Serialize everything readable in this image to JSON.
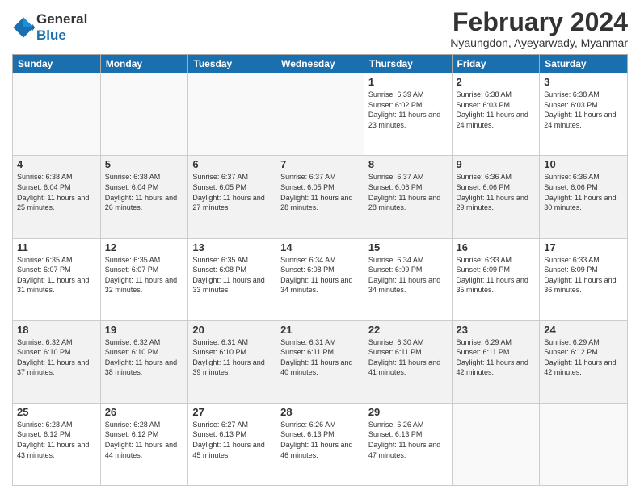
{
  "header": {
    "logo_line1": "General",
    "logo_line2": "Blue",
    "month_title": "February 2024",
    "location": "Nyaungdon, Ayeyarwady, Myanmar"
  },
  "weekdays": [
    "Sunday",
    "Monday",
    "Tuesday",
    "Wednesday",
    "Thursday",
    "Friday",
    "Saturday"
  ],
  "weeks": [
    [
      {
        "day": "",
        "sunrise": "",
        "sunset": "",
        "daylight": ""
      },
      {
        "day": "",
        "sunrise": "",
        "sunset": "",
        "daylight": ""
      },
      {
        "day": "",
        "sunrise": "",
        "sunset": "",
        "daylight": ""
      },
      {
        "day": "",
        "sunrise": "",
        "sunset": "",
        "daylight": ""
      },
      {
        "day": "1",
        "sunrise": "Sunrise: 6:39 AM",
        "sunset": "Sunset: 6:02 PM",
        "daylight": "Daylight: 11 hours and 23 minutes."
      },
      {
        "day": "2",
        "sunrise": "Sunrise: 6:38 AM",
        "sunset": "Sunset: 6:03 PM",
        "daylight": "Daylight: 11 hours and 24 minutes."
      },
      {
        "day": "3",
        "sunrise": "Sunrise: 6:38 AM",
        "sunset": "Sunset: 6:03 PM",
        "daylight": "Daylight: 11 hours and 24 minutes."
      }
    ],
    [
      {
        "day": "4",
        "sunrise": "Sunrise: 6:38 AM",
        "sunset": "Sunset: 6:04 PM",
        "daylight": "Daylight: 11 hours and 25 minutes."
      },
      {
        "day": "5",
        "sunrise": "Sunrise: 6:38 AM",
        "sunset": "Sunset: 6:04 PM",
        "daylight": "Daylight: 11 hours and 26 minutes."
      },
      {
        "day": "6",
        "sunrise": "Sunrise: 6:37 AM",
        "sunset": "Sunset: 6:05 PM",
        "daylight": "Daylight: 11 hours and 27 minutes."
      },
      {
        "day": "7",
        "sunrise": "Sunrise: 6:37 AM",
        "sunset": "Sunset: 6:05 PM",
        "daylight": "Daylight: 11 hours and 28 minutes."
      },
      {
        "day": "8",
        "sunrise": "Sunrise: 6:37 AM",
        "sunset": "Sunset: 6:06 PM",
        "daylight": "Daylight: 11 hours and 28 minutes."
      },
      {
        "day": "9",
        "sunrise": "Sunrise: 6:36 AM",
        "sunset": "Sunset: 6:06 PM",
        "daylight": "Daylight: 11 hours and 29 minutes."
      },
      {
        "day": "10",
        "sunrise": "Sunrise: 6:36 AM",
        "sunset": "Sunset: 6:06 PM",
        "daylight": "Daylight: 11 hours and 30 minutes."
      }
    ],
    [
      {
        "day": "11",
        "sunrise": "Sunrise: 6:35 AM",
        "sunset": "Sunset: 6:07 PM",
        "daylight": "Daylight: 11 hours and 31 minutes."
      },
      {
        "day": "12",
        "sunrise": "Sunrise: 6:35 AM",
        "sunset": "Sunset: 6:07 PM",
        "daylight": "Daylight: 11 hours and 32 minutes."
      },
      {
        "day": "13",
        "sunrise": "Sunrise: 6:35 AM",
        "sunset": "Sunset: 6:08 PM",
        "daylight": "Daylight: 11 hours and 33 minutes."
      },
      {
        "day": "14",
        "sunrise": "Sunrise: 6:34 AM",
        "sunset": "Sunset: 6:08 PM",
        "daylight": "Daylight: 11 hours and 34 minutes."
      },
      {
        "day": "15",
        "sunrise": "Sunrise: 6:34 AM",
        "sunset": "Sunset: 6:09 PM",
        "daylight": "Daylight: 11 hours and 34 minutes."
      },
      {
        "day": "16",
        "sunrise": "Sunrise: 6:33 AM",
        "sunset": "Sunset: 6:09 PM",
        "daylight": "Daylight: 11 hours and 35 minutes."
      },
      {
        "day": "17",
        "sunrise": "Sunrise: 6:33 AM",
        "sunset": "Sunset: 6:09 PM",
        "daylight": "Daylight: 11 hours and 36 minutes."
      }
    ],
    [
      {
        "day": "18",
        "sunrise": "Sunrise: 6:32 AM",
        "sunset": "Sunset: 6:10 PM",
        "daylight": "Daylight: 11 hours and 37 minutes."
      },
      {
        "day": "19",
        "sunrise": "Sunrise: 6:32 AM",
        "sunset": "Sunset: 6:10 PM",
        "daylight": "Daylight: 11 hours and 38 minutes."
      },
      {
        "day": "20",
        "sunrise": "Sunrise: 6:31 AM",
        "sunset": "Sunset: 6:10 PM",
        "daylight": "Daylight: 11 hours and 39 minutes."
      },
      {
        "day": "21",
        "sunrise": "Sunrise: 6:31 AM",
        "sunset": "Sunset: 6:11 PM",
        "daylight": "Daylight: 11 hours and 40 minutes."
      },
      {
        "day": "22",
        "sunrise": "Sunrise: 6:30 AM",
        "sunset": "Sunset: 6:11 PM",
        "daylight": "Daylight: 11 hours and 41 minutes."
      },
      {
        "day": "23",
        "sunrise": "Sunrise: 6:29 AM",
        "sunset": "Sunset: 6:11 PM",
        "daylight": "Daylight: 11 hours and 42 minutes."
      },
      {
        "day": "24",
        "sunrise": "Sunrise: 6:29 AM",
        "sunset": "Sunset: 6:12 PM",
        "daylight": "Daylight: 11 hours and 42 minutes."
      }
    ],
    [
      {
        "day": "25",
        "sunrise": "Sunrise: 6:28 AM",
        "sunset": "Sunset: 6:12 PM",
        "daylight": "Daylight: 11 hours and 43 minutes."
      },
      {
        "day": "26",
        "sunrise": "Sunrise: 6:28 AM",
        "sunset": "Sunset: 6:12 PM",
        "daylight": "Daylight: 11 hours and 44 minutes."
      },
      {
        "day": "27",
        "sunrise": "Sunrise: 6:27 AM",
        "sunset": "Sunset: 6:13 PM",
        "daylight": "Daylight: 11 hours and 45 minutes."
      },
      {
        "day": "28",
        "sunrise": "Sunrise: 6:26 AM",
        "sunset": "Sunset: 6:13 PM",
        "daylight": "Daylight: 11 hours and 46 minutes."
      },
      {
        "day": "29",
        "sunrise": "Sunrise: 6:26 AM",
        "sunset": "Sunset: 6:13 PM",
        "daylight": "Daylight: 11 hours and 47 minutes."
      },
      {
        "day": "",
        "sunrise": "",
        "sunset": "",
        "daylight": ""
      },
      {
        "day": "",
        "sunrise": "",
        "sunset": "",
        "daylight": ""
      }
    ]
  ]
}
